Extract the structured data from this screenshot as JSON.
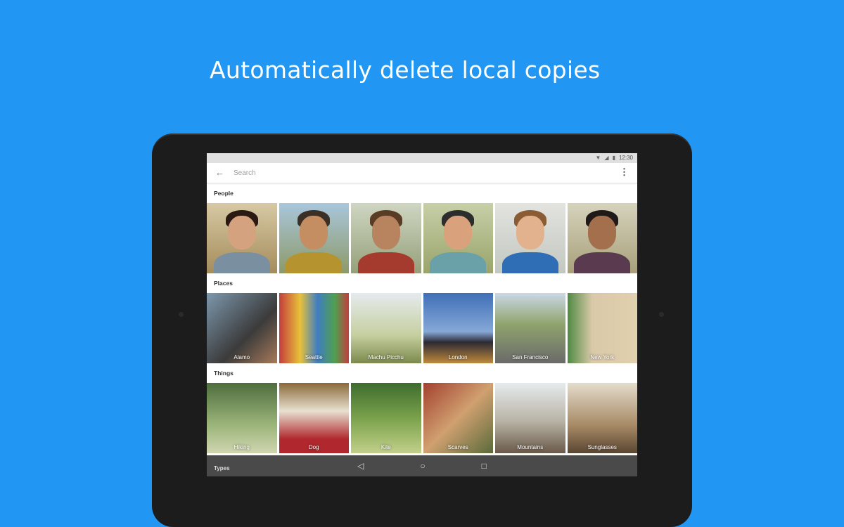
{
  "headline": "Automatically  delete local copies",
  "statusbar": {
    "time": "12:30"
  },
  "appbar": {
    "search_placeholder": "Search"
  },
  "sections": {
    "people": {
      "title": "People"
    },
    "places": {
      "title": "Places",
      "items": [
        {
          "label": "Alamo"
        },
        {
          "label": "Seattle"
        },
        {
          "label": "Machu Picchu"
        },
        {
          "label": "London"
        },
        {
          "label": "San Francisco"
        },
        {
          "label": "New York"
        }
      ]
    },
    "things": {
      "title": "Things",
      "items": [
        {
          "label": "Hiking"
        },
        {
          "label": "Dog"
        },
        {
          "label": "Kite"
        },
        {
          "label": "Scarves"
        },
        {
          "label": "Mountains"
        },
        {
          "label": "Sunglasses"
        }
      ]
    },
    "types": {
      "title": "Types"
    }
  },
  "colors": {
    "background": "#2196f3",
    "tablet": "#1c1c1c",
    "navbar": "#4a4a4a"
  }
}
